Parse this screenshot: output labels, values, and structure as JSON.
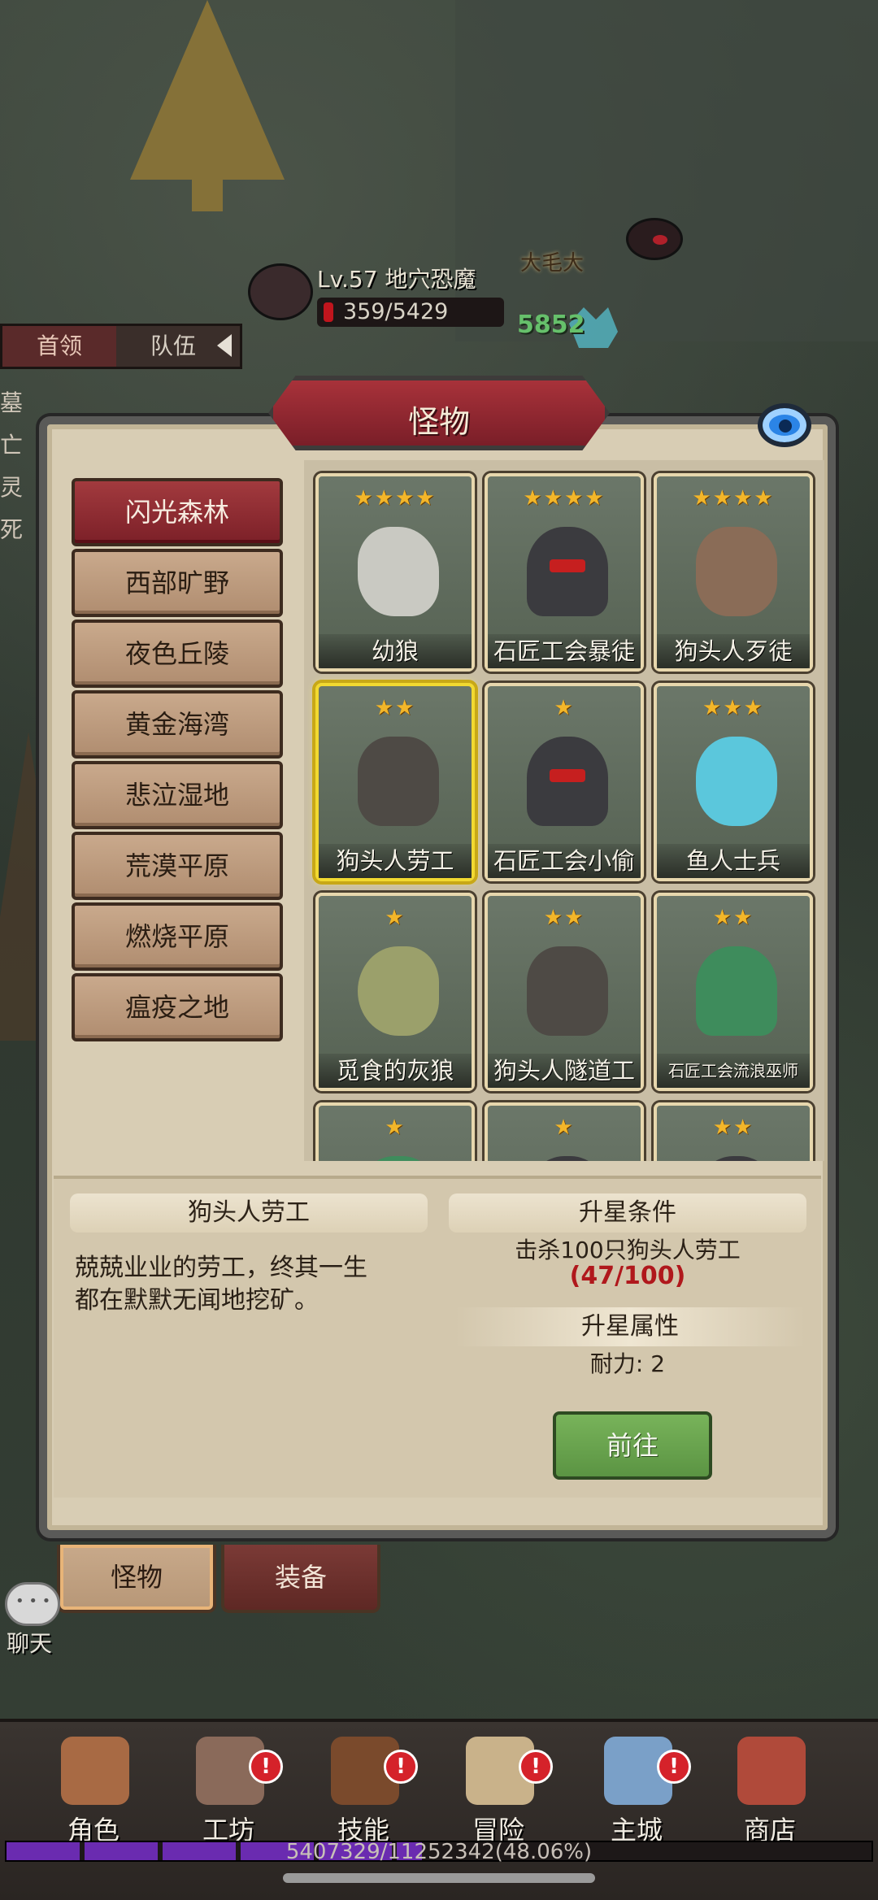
{
  "boss": {
    "level_name": "Lv.57 地穴恐魔",
    "hp": "359/5429"
  },
  "ally": {
    "name": "大毛大",
    "power": "5852"
  },
  "side_tabs": {
    "tab1": "首领",
    "tab2": "队伍"
  },
  "side_list": [
    "墓",
    "亡",
    "灵",
    "死"
  ],
  "panel": {
    "title": "怪物"
  },
  "areas": [
    {
      "label": "闪光森林",
      "active": true
    },
    {
      "label": "西部旷野"
    },
    {
      "label": "夜色丘陵"
    },
    {
      "label": "黄金海湾"
    },
    {
      "label": "悲泣湿地"
    },
    {
      "label": "荒漠平原"
    },
    {
      "label": "燃烧平原"
    },
    {
      "label": "瘟疫之地"
    }
  ],
  "monsters": [
    {
      "name": "幼狼",
      "stars": "★★★★",
      "sprite": "wolf"
    },
    {
      "name": "石匠工会暴徒",
      "stars": "★★★★",
      "sprite": "human"
    },
    {
      "name": "狗头人歹徒",
      "stars": "★★★★",
      "sprite": "gnoll"
    },
    {
      "name": "狗头人劳工",
      "stars": "★★",
      "sprite": "miner",
      "selected": true
    },
    {
      "name": "石匠工会小偷",
      "stars": "★",
      "sprite": "human"
    },
    {
      "name": "鱼人士兵",
      "stars": "★★★",
      "sprite": "fishman"
    },
    {
      "name": "觅食的灰狼",
      "stars": "★",
      "sprite": "greywolf"
    },
    {
      "name": "狗头人隧道工",
      "stars": "★★",
      "sprite": "miner"
    },
    {
      "name": "石匠工会流浪巫师",
      "stars": "★★",
      "sprite": "shaman"
    },
    {
      "name": "",
      "stars": "★",
      "sprite": "shaman"
    },
    {
      "name": "",
      "stars": "★",
      "sprite": "human"
    },
    {
      "name": "",
      "stars": "★★",
      "sprite": "human"
    }
  ],
  "detail": {
    "name": "狗头人劳工",
    "description_line1": "兢兢业业的劳工，终其一生",
    "description_line2": "都在默默无闻地挖矿。",
    "star_condition_title": "升星条件",
    "star_condition_text": "击杀100只狗头人劳工",
    "star_condition_progress": "(47/100)",
    "star_attr_title": "升星属性",
    "star_attr_text": "耐力: 2",
    "go_button": "前往"
  },
  "panel_tabs": {
    "monster": "怪物",
    "equipment": "装备"
  },
  "chat": {
    "label": "聊天"
  },
  "bottom_nav": [
    {
      "label": "角色",
      "alert": false,
      "color": "#a86a44"
    },
    {
      "label": "工坊",
      "alert": true,
      "color": "#8a6a5a"
    },
    {
      "label": "技能",
      "alert": true,
      "color": "#7a4a2c"
    },
    {
      "label": "冒险",
      "alert": true,
      "color": "#c9b28a"
    },
    {
      "label": "主城",
      "alert": true,
      "color": "#7aa0c8"
    },
    {
      "label": "商店",
      "alert": false,
      "color": "#b04a3a"
    }
  ],
  "alert_symbol": "!",
  "xp": {
    "text": "5407329/11252342(48.06%)",
    "fraction": 0.4806
  },
  "colors": {
    "star": "#f3b629",
    "selected_border": "#f2d930",
    "accent_red": "#a23a3e"
  }
}
